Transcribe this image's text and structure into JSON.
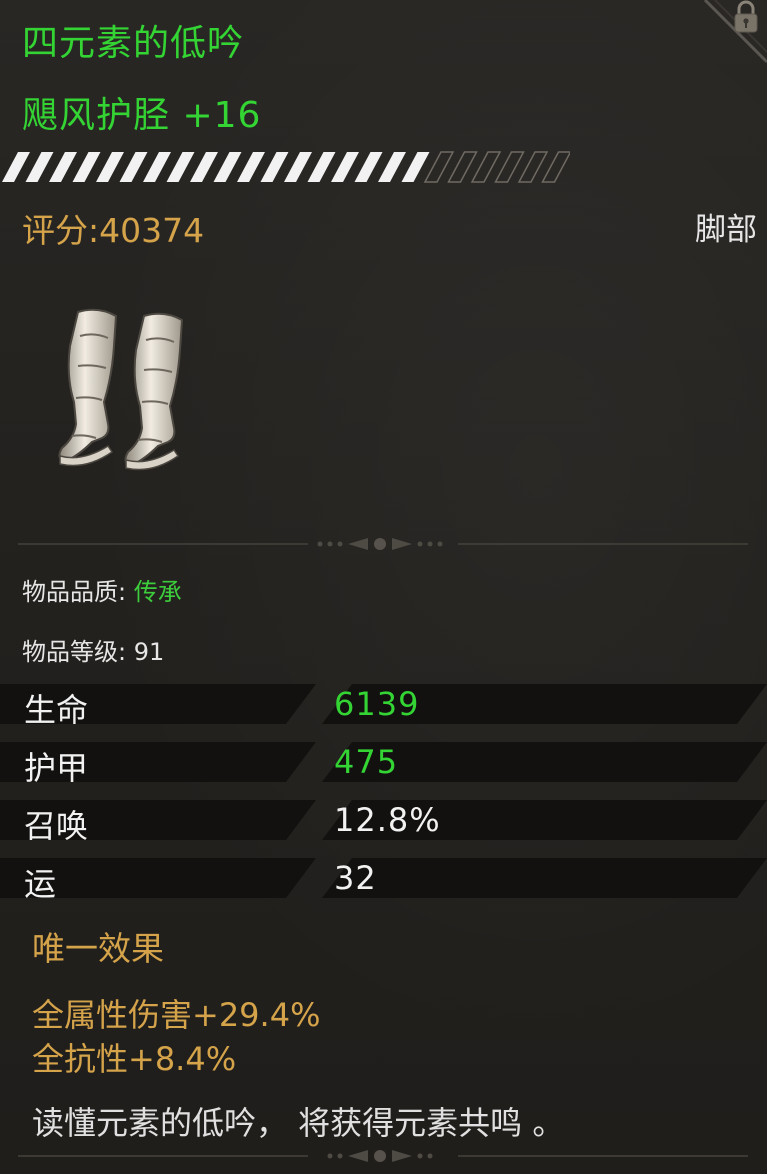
{
  "item": {
    "set_name": "四元素的低吟",
    "name": "飓风护胫 +16",
    "score": "评分:40374",
    "slot": "脚部",
    "image_icon": "greaves-icon",
    "enhancement_progress": 0.75
  },
  "info": {
    "quality_label": "物品品质: ",
    "quality_value": "传承",
    "level_label": "物品等级: ",
    "level_value": "91"
  },
  "stats": [
    {
      "label": "生命",
      "value": "6139"
    },
    {
      "label": "护甲",
      "value": "475"
    },
    {
      "label": "召唤",
      "value": "12.8%"
    },
    {
      "label": "运",
      "value": "32"
    }
  ],
  "unique": {
    "title": "唯一效果",
    "effects": [
      "全属性伤害+29.4%",
      "全抗性+8.4%"
    ]
  },
  "lore": "读懂元素的低吟， 将获得元素共鸣 。",
  "colors": {
    "set_green": "#33d433",
    "gold": "#d4a34a",
    "text": "#e6e6e6",
    "background": "#22201d"
  },
  "icons": [
    "lock-icon",
    "greaves-icon",
    "ornament-divider"
  ]
}
